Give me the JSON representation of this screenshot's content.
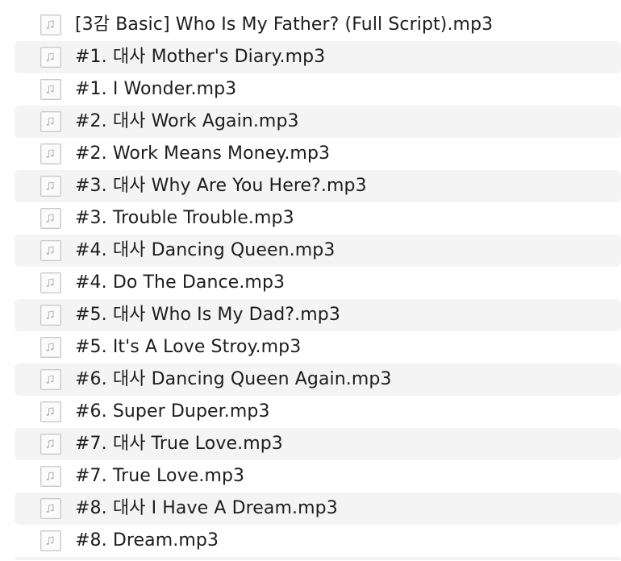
{
  "files": [
    {
      "name": "[3감 Basic] Who Is My Father? (Full Script).mp3",
      "icon": "audio-file-icon"
    },
    {
      "name": "#1. 대사 Mother's Diary.mp3",
      "icon": "audio-file-icon"
    },
    {
      "name": "#1. I Wonder.mp3",
      "icon": "audio-file-icon"
    },
    {
      "name": "#2. 대사 Work Again.mp3",
      "icon": "audio-file-icon"
    },
    {
      "name": "#2. Work Means Money.mp3",
      "icon": "audio-file-icon"
    },
    {
      "name": "#3. 대사 Why Are You Here?.mp3",
      "icon": "audio-file-icon"
    },
    {
      "name": "#3. Trouble Trouble.mp3",
      "icon": "audio-file-icon"
    },
    {
      "name": "#4. 대사 Dancing Queen.mp3",
      "icon": "audio-file-icon"
    },
    {
      "name": "#4. Do The Dance.mp3",
      "icon": "audio-file-icon"
    },
    {
      "name": "#5. 대사 Who Is My Dad?.mp3",
      "icon": "audio-file-icon"
    },
    {
      "name": "#5. It's A Love Stroy.mp3",
      "icon": "audio-file-icon"
    },
    {
      "name": "#6. 대사 Dancing Queen Again.mp3",
      "icon": "audio-file-icon"
    },
    {
      "name": "#6. Super Duper.mp3",
      "icon": "audio-file-icon"
    },
    {
      "name": "#7. 대사 True Love.mp3",
      "icon": "audio-file-icon"
    },
    {
      "name": "#7. True Love.mp3",
      "icon": "audio-file-icon"
    },
    {
      "name": "#8. 대사 I Have A Dream.mp3",
      "icon": "audio-file-icon"
    },
    {
      "name": "#8. Dream.mp3",
      "icon": "audio-file-icon"
    }
  ],
  "colors": {
    "row_alt_background": "#f4f4f4",
    "text": "#1d1d1f",
    "icon_border": "#c8c8c8"
  }
}
